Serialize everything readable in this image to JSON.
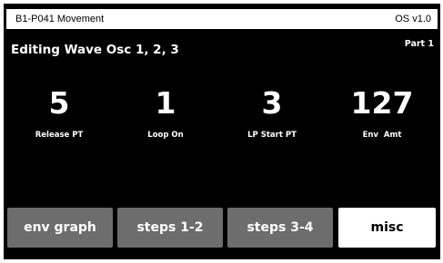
{
  "status_bar": {
    "patch_name": "B1-P041 Movement",
    "os_version": "OS v1.0"
  },
  "header": {
    "title": "Editing Wave Osc 1, 2, 3",
    "part": "Part 1"
  },
  "params": [
    {
      "value": "5",
      "label": "Release PT"
    },
    {
      "value": "1",
      "label": "Loop On"
    },
    {
      "value": "3",
      "label": "LP Start PT"
    },
    {
      "value": "127",
      "label": "Env  Amt"
    }
  ],
  "tabs": [
    {
      "label": "env graph",
      "active": false
    },
    {
      "label": "steps 1-2",
      "active": false
    },
    {
      "label": "steps 3-4",
      "active": false
    },
    {
      "label": "misc",
      "active": true
    }
  ],
  "colors": {
    "screen_bg": "#000000",
    "tab_inactive": "#6d6d6d",
    "tab_active": "#ffffff"
  }
}
